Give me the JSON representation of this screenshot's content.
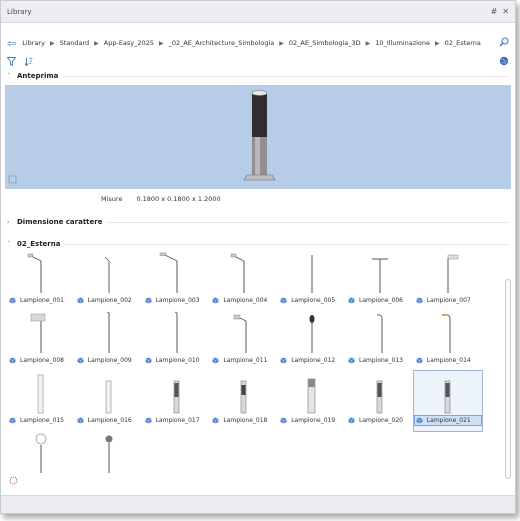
{
  "window": {
    "title": "Library",
    "pin_glyph": "#",
    "close_glyph": "✕"
  },
  "breadcrumb": [
    "Library",
    "Standard",
    "App-Easy_2025",
    "_02_AE_Architecture_Simbologia",
    "02_AE_Simbologia_3D",
    "10_Illuminazione",
    "02_Esterna"
  ],
  "sections": {
    "preview": "Anteprima",
    "dimension": "Dimensione carattere",
    "folder": "02_Esterna"
  },
  "measure": {
    "label": "Misure",
    "value": "0.1800 x 0.1800 x 1.2000"
  },
  "items": [
    {
      "label": "Lampione_001",
      "kind": "pole-arm-left"
    },
    {
      "label": "Lampione_002",
      "kind": "pole-slim-arm"
    },
    {
      "label": "Lampione_003",
      "kind": "pole-long-arm"
    },
    {
      "label": "Lampione_004",
      "kind": "pole-arm-left"
    },
    {
      "label": "Lampione_005",
      "kind": "pole-slim"
    },
    {
      "label": "Lampione_006",
      "kind": "pole-t"
    },
    {
      "label": "Lampione_007",
      "kind": "pole-flag"
    },
    {
      "label": "Lampione_008",
      "kind": "pole-box"
    },
    {
      "label": "Lampione_009",
      "kind": "pole-slim-tall"
    },
    {
      "label": "Lampione_010",
      "kind": "pole-slim-tall"
    },
    {
      "label": "Lampione_011",
      "kind": "pole-arm-box"
    },
    {
      "label": "Lampione_012",
      "kind": "pole-lantern"
    },
    {
      "label": "Lampione_013",
      "kind": "pole-curve"
    },
    {
      "label": "Lampione_014",
      "kind": "pole-curve-orange"
    },
    {
      "label": "Lampione_015",
      "kind": "bollard-hook"
    },
    {
      "label": "Lampione_016",
      "kind": "bollard"
    },
    {
      "label": "Lampione_017",
      "kind": "bollard-dark"
    },
    {
      "label": "Lampione_018",
      "kind": "bollard-dark2"
    },
    {
      "label": "Lampione_019",
      "kind": "bollard-grey"
    },
    {
      "label": "Lampione_020",
      "kind": "bollard-dark"
    },
    {
      "label": "Lampione_021",
      "kind": "bollard-dark",
      "selected": true
    },
    {
      "label": "",
      "kind": "globe-white"
    },
    {
      "label": "",
      "kind": "globe-grey"
    }
  ]
}
